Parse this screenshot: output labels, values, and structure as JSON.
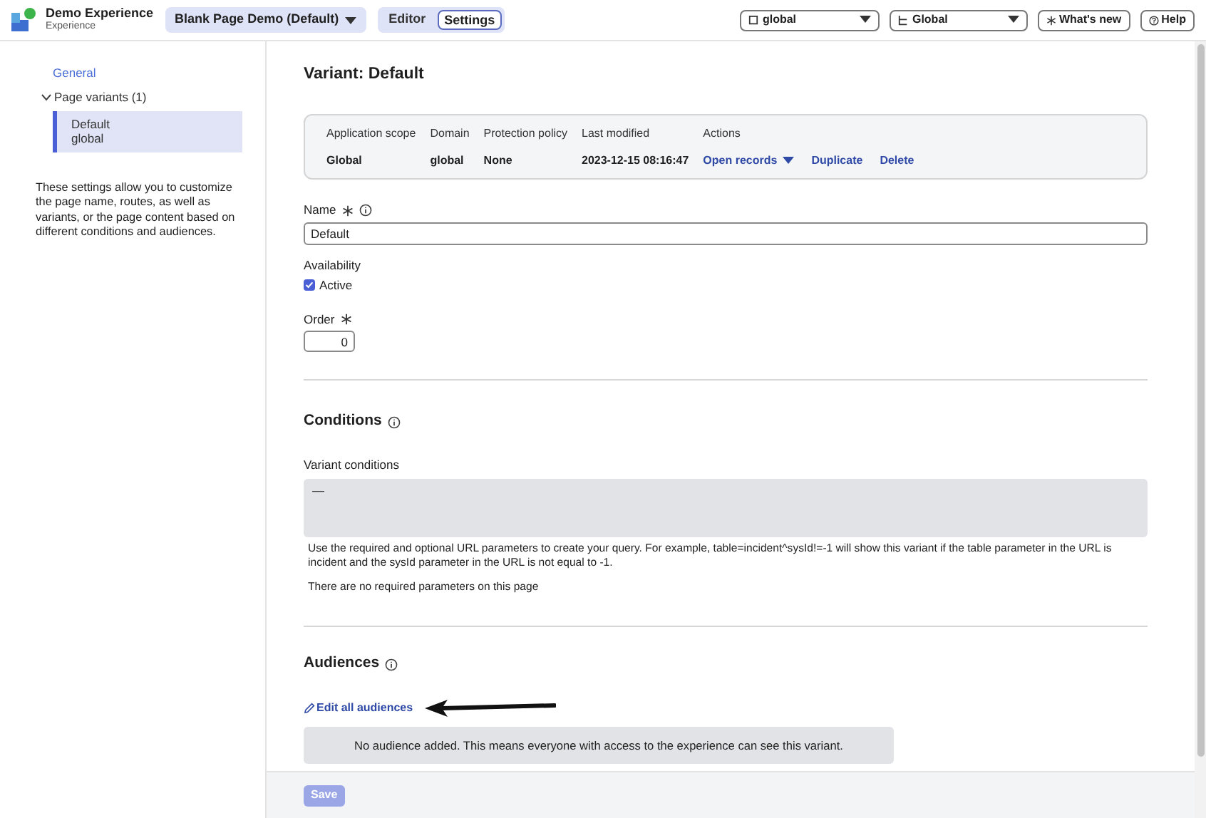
{
  "header": {
    "app_title": "Demo Experience",
    "app_subtitle": "Experience",
    "page_menu": "Blank Page Demo (Default)",
    "mode_tabs": [
      {
        "label": "Editor",
        "selected": false
      },
      {
        "label": "Settings",
        "selected": true
      }
    ],
    "scope_select": "global",
    "domain_select": "Global",
    "whats_new": "What's new",
    "help": "Help"
  },
  "sidebar": {
    "items": [
      {
        "label": "General",
        "selected": false
      },
      {
        "label": "Page variants (1)",
        "expanded": true,
        "children": [
          {
            "label": "Default",
            "sublabel": "global",
            "selected": true
          }
        ]
      }
    ],
    "description": "These settings allow you to customize the page name, routes, as well as variants, or the page content based on different conditions and audiences."
  },
  "variant": {
    "title": "Variant: Default",
    "columns": [
      "Application scope",
      "Domain",
      "Protection policy",
      "Last modified",
      "Actions"
    ],
    "values": [
      "Global",
      "global",
      "None",
      "2023-12-15 08:16:47"
    ],
    "actions": [
      {
        "label": "Open records",
        "kind": "menu"
      },
      {
        "label": "Duplicate",
        "kind": "link"
      },
      {
        "label": "Delete",
        "kind": "link"
      }
    ],
    "name_label": "Name",
    "name_value": "Default",
    "availability_label": "Availability",
    "active": {
      "label": "Active",
      "checked": true
    },
    "order_label": "Order",
    "order_value": "0"
  },
  "conditions": {
    "title": "Conditions",
    "field_label": "Variant conditions",
    "field_value": "—",
    "help": "Use the required and optional URL parameters to create your query. For example, table=incident^sysId!=-1 will show this variant if the table parameter in the URL is incident and the sysId parameter in the URL is not equal to -1.",
    "note": "There are no required parameters on this page"
  },
  "audiences": {
    "title": "Audiences",
    "edit_link": "Edit all audiences",
    "empty_message": "No audience added. This means everyone with access to the experience can see this variant."
  },
  "footer": {
    "save": {
      "label": "Save",
      "disabled": true
    }
  }
}
